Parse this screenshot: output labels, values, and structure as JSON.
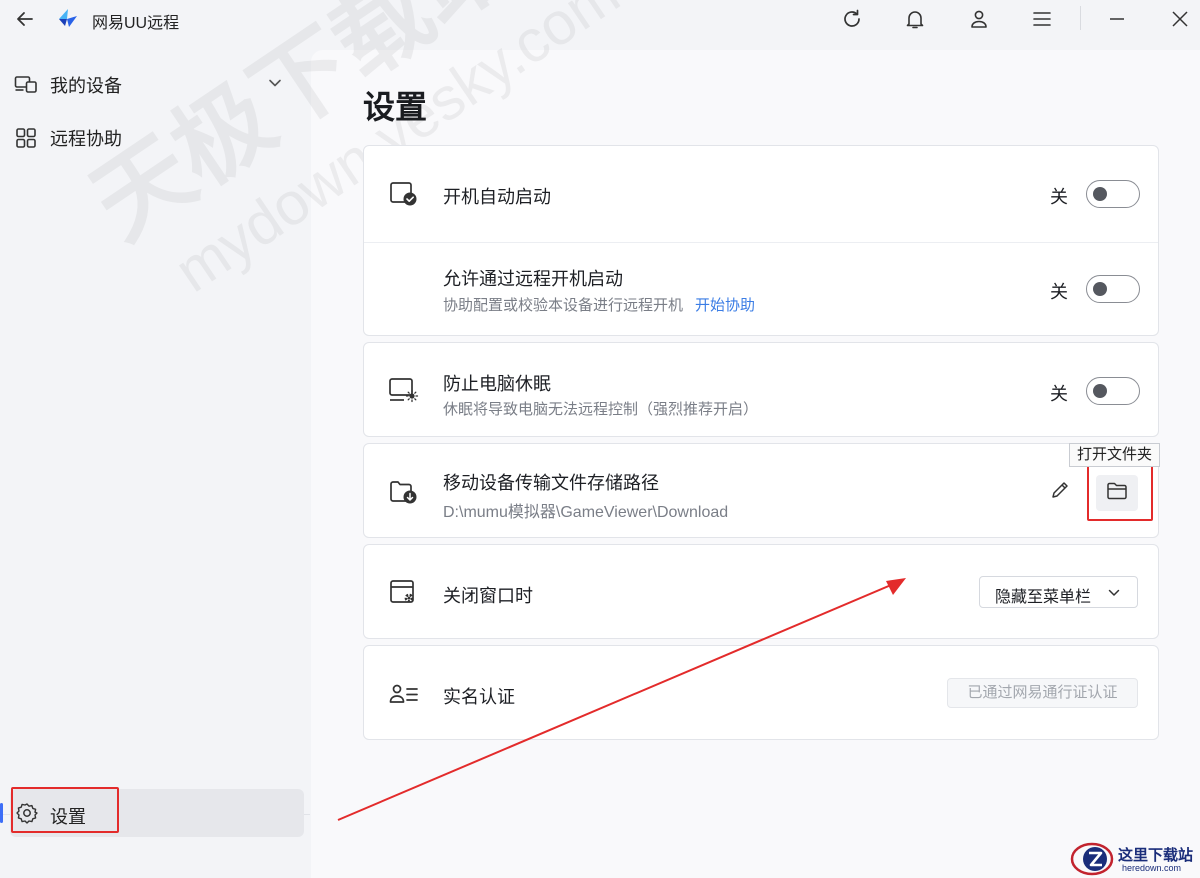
{
  "app": {
    "title": "网易UU远程"
  },
  "sidebar": {
    "items": [
      {
        "label": "我的设备",
        "icon": "devices-icon",
        "expandable": true
      },
      {
        "label": "远程协助",
        "icon": "remote-assist-icon"
      }
    ],
    "settings_label": "设置"
  },
  "page": {
    "title": "设置"
  },
  "settings": {
    "autostart": {
      "title": "开机自动启动",
      "state_label": "关",
      "on": false
    },
    "remote_boot": {
      "title": "允许通过远程开机启动",
      "sub": "协助配置或校验本设备进行远程开机",
      "link": "开始协助",
      "state_label": "关",
      "on": false
    },
    "prevent_sleep": {
      "title": "防止电脑休眠",
      "sub": "休眠将导致电脑无法远程控制（强烈推荐开启）",
      "state_label": "关",
      "on": false
    },
    "storage_path": {
      "title": "移动设备传输文件存储路径",
      "path": "D:\\mumu模拟器\\GameViewer\\Download",
      "tooltip": "打开文件夹"
    },
    "close_window": {
      "title": "关闭窗口时",
      "selected": "隐藏至菜单栏"
    },
    "real_name": {
      "title": "实名认证",
      "status": "已通过网易通行证认证"
    }
  },
  "watermark": {
    "line1": "天极下载站",
    "line2": "mydown.yesky.com"
  },
  "corner_logo": {
    "cn": "这里下载站",
    "en": "heredown.com"
  },
  "colors": {
    "accent": "#3d6ef7",
    "link": "#3b7de5",
    "annotation_red": "#e32b2b"
  }
}
